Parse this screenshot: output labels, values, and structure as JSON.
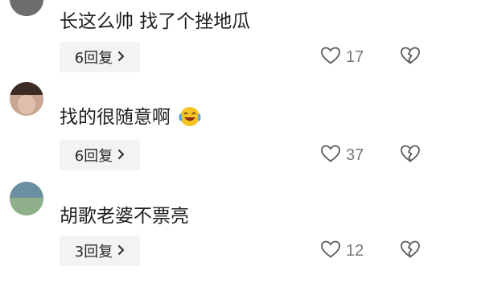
{
  "comments": [
    {
      "text": "长这么帅 找了个挫地瓜",
      "reply_label": "6回复",
      "like_count": "17",
      "avatar_colors": [
        "#2a2a2a",
        "#7a7a7a"
      ]
    },
    {
      "text": "找的很随意啊",
      "emoji": "laughing-crying-emoji",
      "reply_label": "6回复",
      "like_count": "37",
      "avatar_colors": [
        "#3b2a25",
        "#c9a593"
      ]
    },
    {
      "text": "胡歌老婆不票亮",
      "reply_label": "3回复",
      "like_count": "12",
      "avatar_colors": [
        "#6a8fa0",
        "#a9c0bd"
      ]
    }
  ],
  "icons": {
    "chevron": "chevron-right-icon",
    "like": "heart-outline-icon",
    "dislike": "broken-heart-icon"
  },
  "colors": {
    "text": "#1f1f1f",
    "reply_bg": "#f3f3f3",
    "count": "#777777",
    "icon_stroke": "#5a5a5a"
  }
}
